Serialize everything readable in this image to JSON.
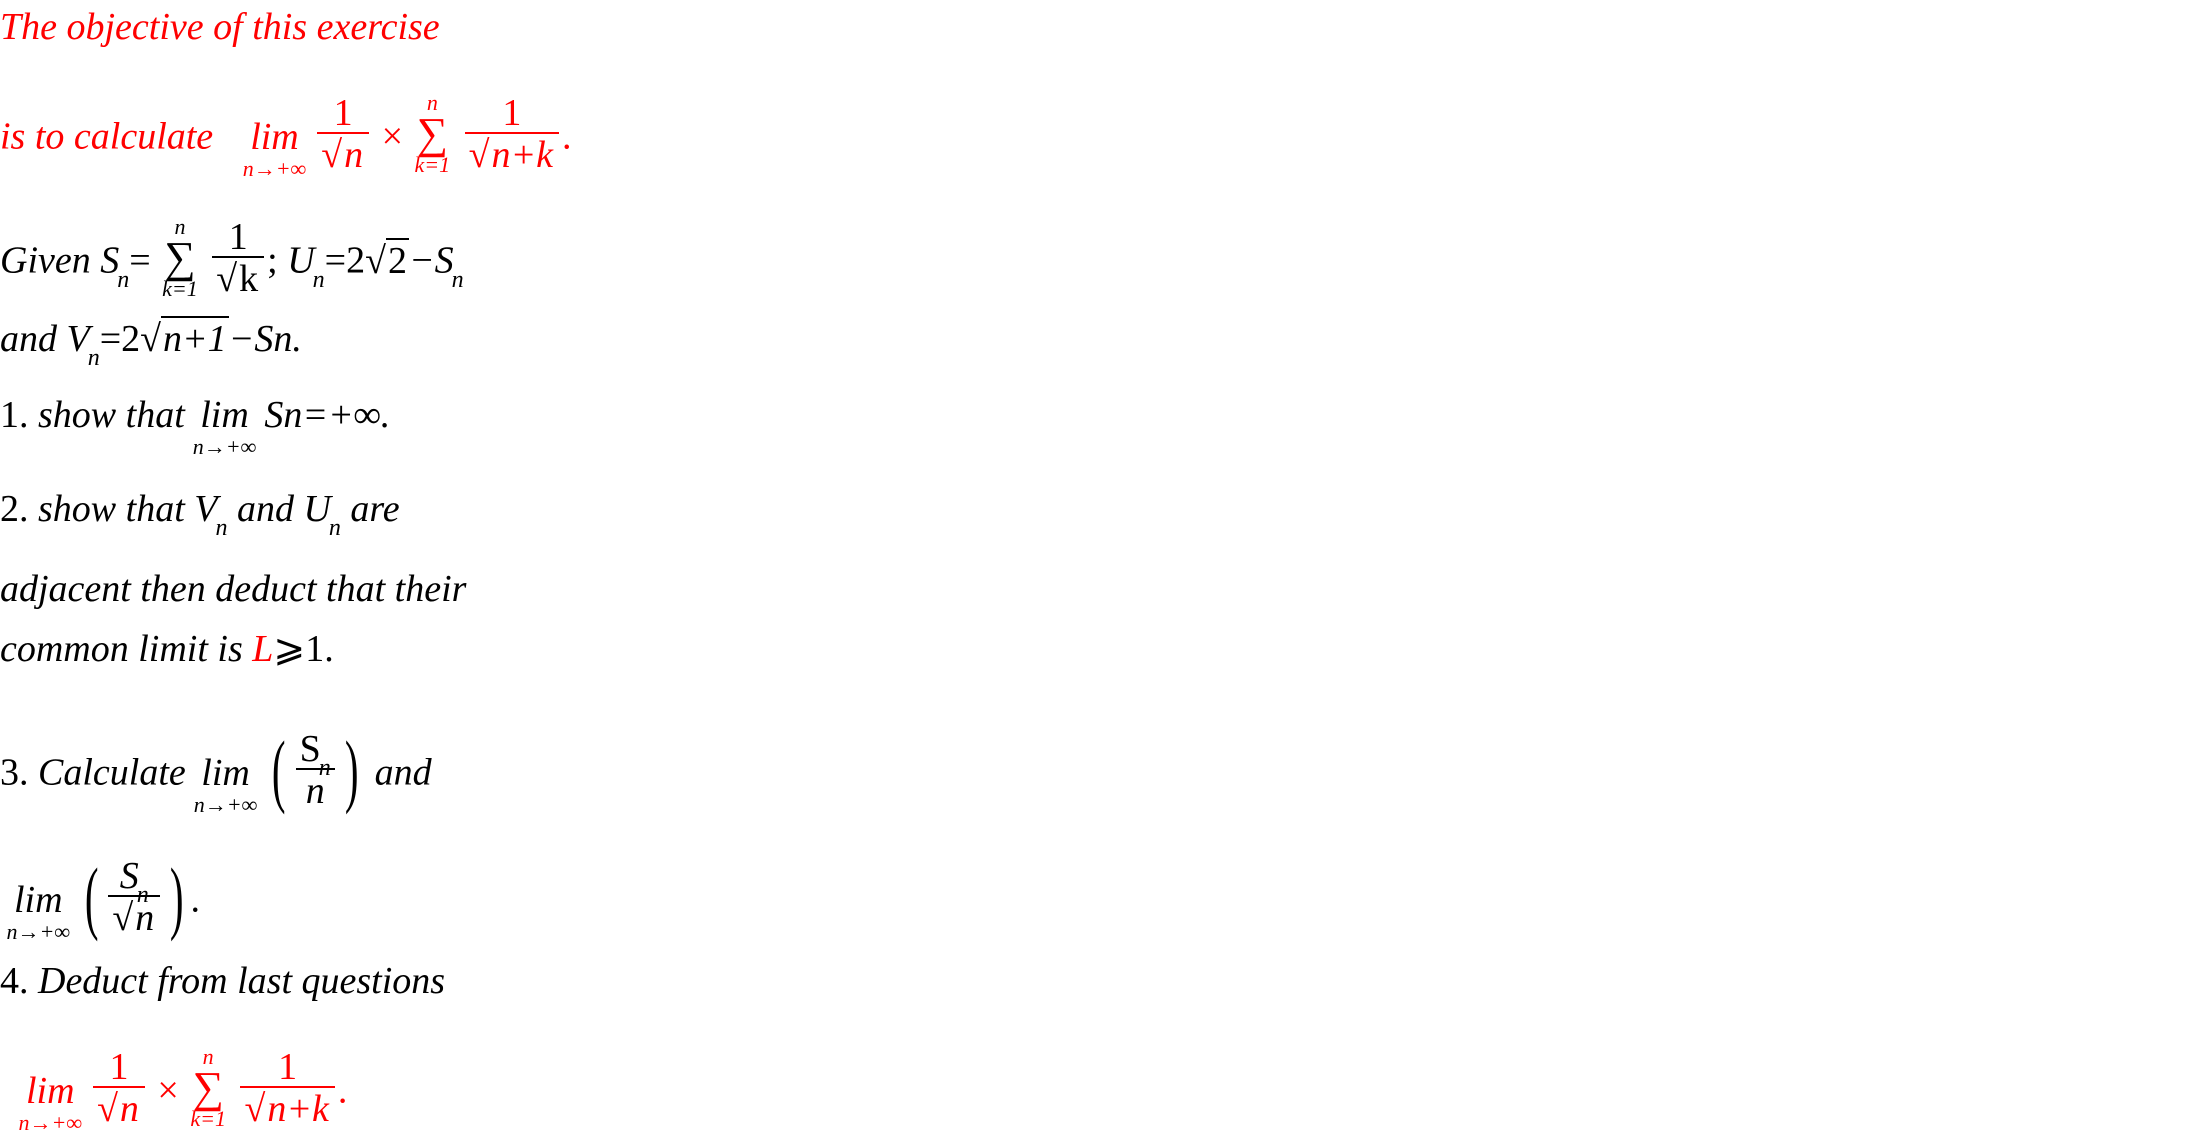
{
  "colors": {
    "accent": "#ff0000",
    "text": "#000000",
    "background": "#ffffff"
  },
  "intro": {
    "line1": "The objective of this exercise",
    "line2_prefix": "is to calculate",
    "lim_word": "lim",
    "lim_under": "n→+∞",
    "frac1_num": "1",
    "frac1_den": "n",
    "times": "×",
    "sum_top": "n",
    "sum_symbol": "∑",
    "sum_bottom": "k=1",
    "frac2_num": "1",
    "frac2_den": "n+k",
    "end": "."
  },
  "given": {
    "word": "Given",
    "S": "S",
    "n_sub": "n",
    "eq": "=",
    "sum_top": "n",
    "sum_symbol": "∑",
    "sum_bottom": "k=1",
    "frac_num": "1",
    "frac_den": "k",
    "semicolon": ";",
    "U": "U",
    "u_rhs_pre": "=2",
    "u_rad": "2",
    "u_rhs_post": "−S",
    "and_word": "and",
    "V": "V",
    "v_rhs_pre": "=2",
    "v_rad": "n+1",
    "v_rhs_post": "−Sn."
  },
  "questions": [
    {
      "number": "1.",
      "prefix": "show  that",
      "lim_word": "lim",
      "lim_under": "n→+∞",
      "suffix": "Sn=+∞."
    },
    {
      "number": "2.",
      "text_a": "show that",
      "V": "V",
      "n_sub": "n",
      "text_b": "and",
      "U": "U",
      "text_c": "are",
      "line2": "adjacent then deduct that  their",
      "line3_a": "common limit is",
      "line3_L": "L",
      "line3_b": "⩾1."
    },
    {
      "number": "3.",
      "prefix": "Calculate",
      "lim_word": "lim",
      "lim_under": "n→+∞",
      "frac1_num": "S",
      "frac1_sub": "n",
      "frac1_den": "n",
      "mid": "and",
      "frac2_num": "S",
      "frac2_sub": "n",
      "frac2_den": "n",
      "end": "."
    },
    {
      "number": "4.",
      "text": "Deduct from last questions",
      "lim_word": "lim",
      "lim_under": "n→+∞",
      "frac1_num": "1",
      "frac1_den": "n",
      "times": "×",
      "sum_top": "n",
      "sum_symbol": "∑",
      "sum_bottom": "k=1",
      "frac2_num": "1",
      "frac2_den": "n+k",
      "end": "."
    }
  ],
  "paren_open": "(",
  "paren_close": ")",
  "radical": "√"
}
